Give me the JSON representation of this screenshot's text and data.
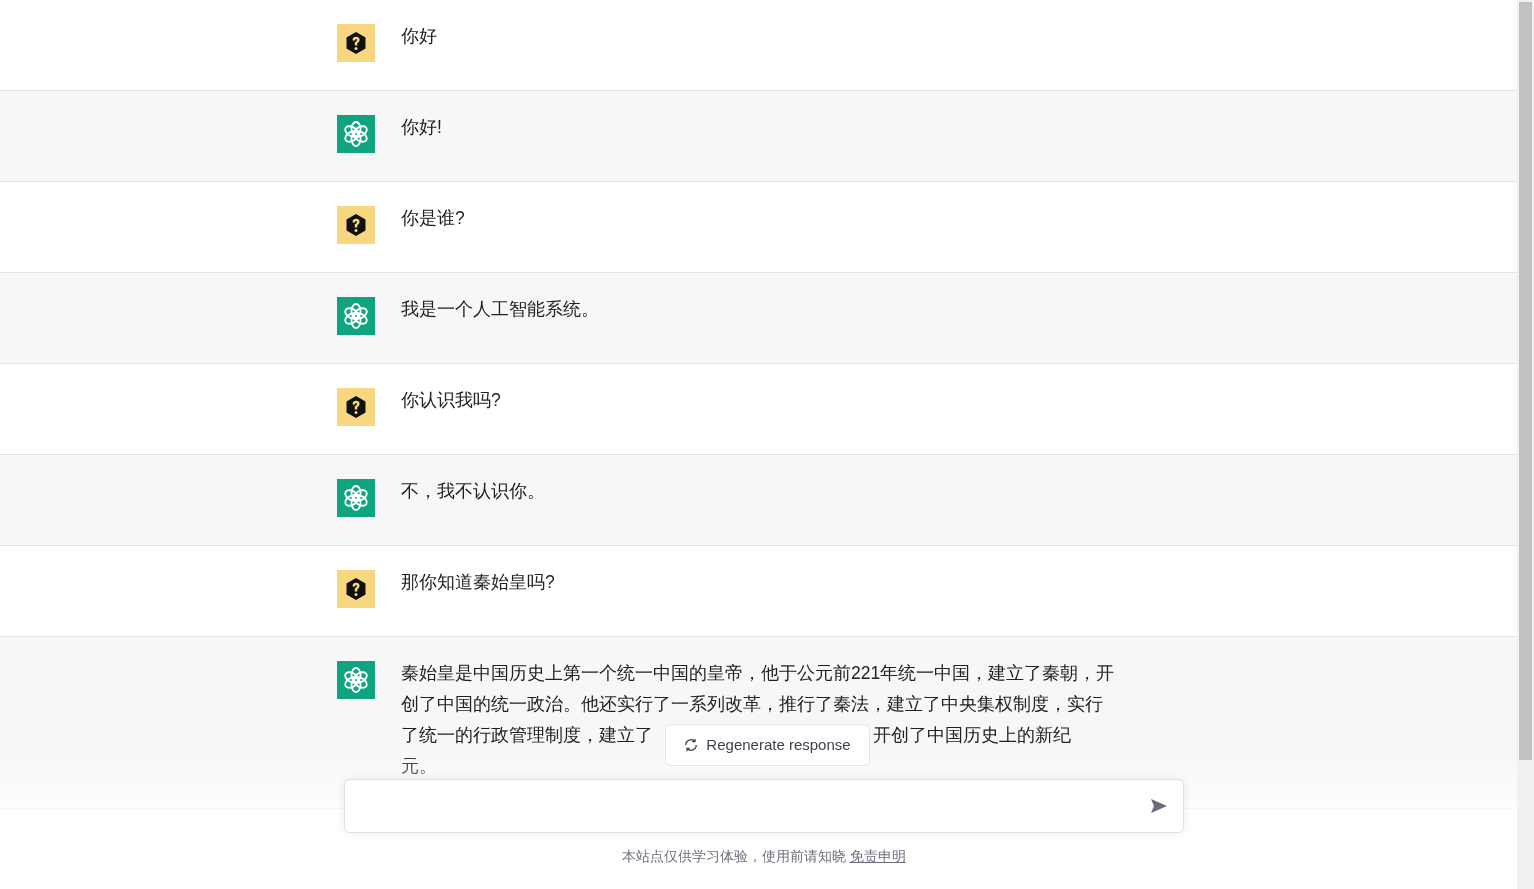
{
  "messages": [
    {
      "kind": "user",
      "lines": [
        [
          "你好"
        ]
      ]
    },
    {
      "kind": "assistant",
      "lines": [
        [
          "你好!"
        ]
      ]
    },
    {
      "kind": "user",
      "lines": [
        [
          "你是谁?"
        ]
      ]
    },
    {
      "kind": "assistant",
      "lines": [
        [
          "我是一个人工智能系统。"
        ]
      ]
    },
    {
      "kind": "user",
      "lines": [
        [
          "你认识我吗?"
        ]
      ]
    },
    {
      "kind": "assistant",
      "lines": [
        [
          "不，我不认识你。"
        ]
      ]
    },
    {
      "kind": "user",
      "lines": [
        [
          "那你知道秦始皇吗?"
        ]
      ]
    },
    {
      "kind": "assistant",
      "lines": [
        [
          "秦始皇是中国历史上第一个统一中国的皇帝，他于公元前221年统一中国，建立了秦朝，开"
        ],
        [
          "创了中国的统一政治。他还实行了一系列改革，推行了秦法，建立了中央集权制度，实行"
        ],
        [
          "了统一的行政管理制度，建立了",
          "开创了中国历史上的新纪"
        ],
        [
          "元。"
        ]
      ]
    }
  ],
  "regenerate_button": "Regenerate response",
  "footer": {
    "text": "本站点仅供学习体验，使用前请知晓",
    "link": "免责申明"
  }
}
